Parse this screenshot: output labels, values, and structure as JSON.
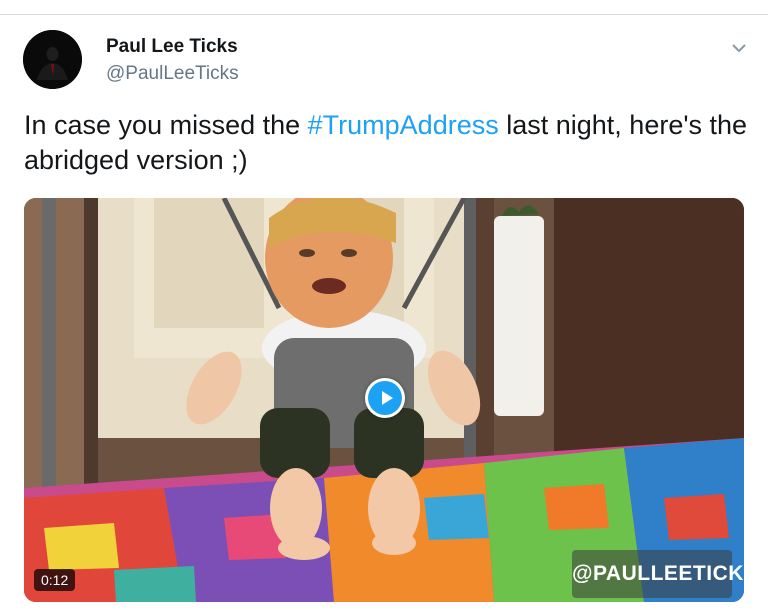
{
  "tweet": {
    "author": {
      "display_name": "Paul Lee Ticks",
      "handle": "@PaulLeeTicks"
    },
    "text_before": "In case you missed the ",
    "hashtag": "#TrumpAddress",
    "text_after": " last night, here's the abridged version ;)",
    "media": {
      "duration": "0:12",
      "watermark": "@PAULLEETICKS"
    },
    "menu_icon": "chevron-down-icon"
  },
  "colors": {
    "link": "#1da1f2",
    "text": "#14171a",
    "secondary": "#657786"
  }
}
